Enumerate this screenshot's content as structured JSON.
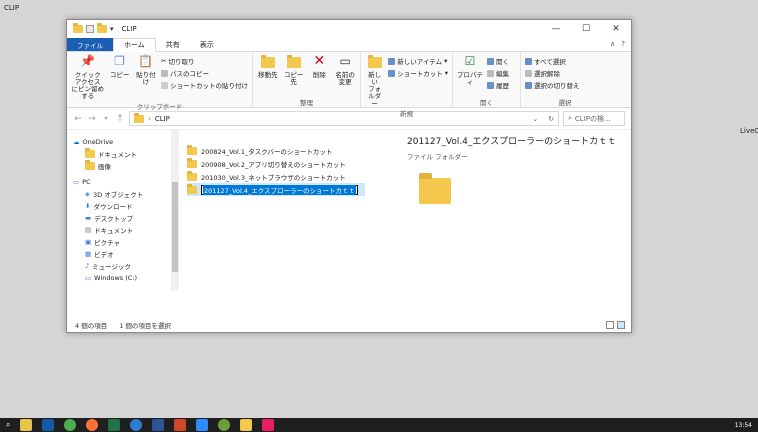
{
  "desktop": {
    "top_left": "CLIP",
    "right_label": "LiveC"
  },
  "window": {
    "title": "CLIP",
    "controls": {
      "minimize": "—",
      "maximize": "☐",
      "close": "✕"
    }
  },
  "tabs": {
    "file": "ファイル",
    "home": "ホーム",
    "share": "共有",
    "view": "表示"
  },
  "ribbon": {
    "clipboard": {
      "label": "クリップボード",
      "pin": "クイック アクセス\nにピン留めする",
      "copy": "コピー",
      "paste": "貼り付け",
      "cut": "切り取り",
      "copy_path": "パスのコピー",
      "paste_shortcut": "ショートカットの貼り付け"
    },
    "organize": {
      "label": "整理",
      "move_to": "移動先",
      "copy_to": "コピー先",
      "delete": "削除",
      "rename": "名前の\n変更"
    },
    "new": {
      "label": "新規",
      "new_folder": "新しい\nフォルダー",
      "new_item": "新しいアイテム",
      "shortcut": "ショートカット"
    },
    "open": {
      "label": "開く",
      "properties": "プロパティ",
      "open": "開く",
      "edit": "編集",
      "history": "履歴"
    },
    "select": {
      "label": "選択",
      "select_all": "すべて選択",
      "select_none": "選択解除",
      "invert": "選択の切り替え"
    }
  },
  "address": {
    "path": "CLIP",
    "search_placeholder": "CLIPの検..."
  },
  "nav_pane": [
    {
      "label": "OneDrive",
      "icon": "cloud-icon"
    },
    {
      "label": "ドキュメント",
      "icon": "folder-icon"
    },
    {
      "label": "画像",
      "icon": "folder-icon"
    },
    {
      "label": "PC",
      "icon": "pc-icon"
    },
    {
      "label": "3D オブジェクト",
      "icon": "cube-icon"
    },
    {
      "label": "ダウンロード",
      "icon": "download-icon"
    },
    {
      "label": "デスクトップ",
      "icon": "desktop-icon"
    },
    {
      "label": "ドキュメント",
      "icon": "document-icon"
    },
    {
      "label": "ピクチャ",
      "icon": "picture-icon"
    },
    {
      "label": "ビデオ",
      "icon": "video-icon"
    },
    {
      "label": "ミュージック",
      "icon": "music-icon"
    },
    {
      "label": "Windows (C:)",
      "icon": "drive-icon"
    }
  ],
  "files": [
    {
      "name": "200824_Vol.1_タスクバーのショートカット"
    },
    {
      "name": "200908_Vol.2_アプリ切り替えのショートカット"
    },
    {
      "name": "201030_Vol.3_ネットブラウザのショートカット"
    },
    {
      "name": "201127_Vol.4_エクスプローラーのショートカｔｔ"
    }
  ],
  "preview": {
    "title": "201127_Vol.4_エクスプローラーのショートカｔｔ",
    "type": "ファイル フォルダー"
  },
  "status": {
    "count": "4 個の項目",
    "selected": "1 個の項目を選択"
  },
  "taskbar": {
    "clock": "13:54"
  },
  "colors": {
    "accent": "#1a5fb4",
    "folder": "#f3c84d",
    "selection": "#cce8ff"
  }
}
